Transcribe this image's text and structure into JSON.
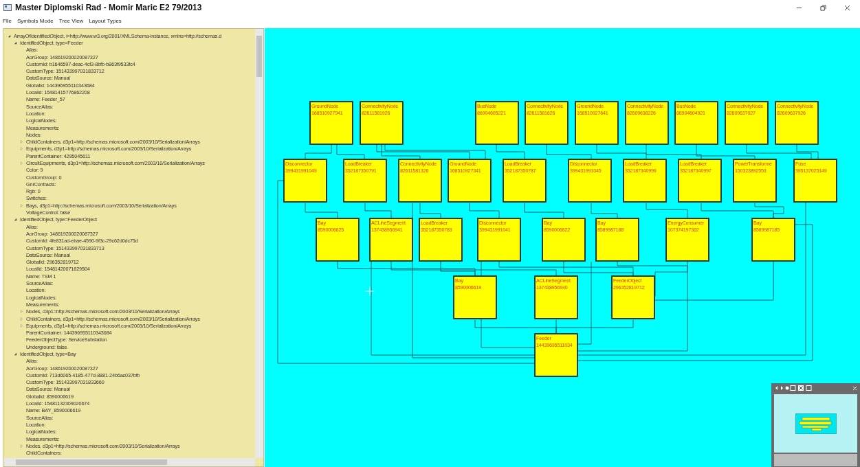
{
  "window": {
    "title": "Master Diplomski Rad - Momir Maric E2 79/2013"
  },
  "menu": [
    "File",
    "Symbols Mode",
    "Tree View",
    "Layout Types"
  ],
  "tree": [
    {
      "text": "ArrayOfIdentifiedObject, i=http://www.w3.org/2001/XMLSchema-instance, xmlns=http://schemas.d",
      "kind": "expanded",
      "children": [
        {
          "text": "IdentifiedObject, type=Feeder",
          "kind": "expanded",
          "children": [
            {
              "text": "Alias:",
              "kind": "leaf"
            },
            {
              "text": "AorGroup: 148619200020087327",
              "kind": "leaf"
            },
            {
              "text": "CustomId: b1646597-deac-4cf3-8bfb-b863f9533fc4",
              "kind": "leaf"
            },
            {
              "text": "CustomType: 151433997031833712",
              "kind": "leaf"
            },
            {
              "text": "DataSource: Manual",
              "kind": "leaf"
            },
            {
              "text": "GlobalId: 144396955110343684",
              "kind": "leaf"
            },
            {
              "text": "LocalId: 15481415776862208",
              "kind": "leaf"
            },
            {
              "text": "Name: Feeder_57",
              "kind": "leaf"
            },
            {
              "text": "SourceAlias:",
              "kind": "leaf"
            },
            {
              "text": "Location:",
              "kind": "leaf"
            },
            {
              "text": "LogicalNodes:",
              "kind": "leaf"
            },
            {
              "text": "Measurements:",
              "kind": "leaf"
            },
            {
              "text": "Nodes:",
              "kind": "leaf"
            },
            {
              "text": "ChildContainers, d3p1=http://schemas.microsoft.com/2003/10/Serialization/Arrays",
              "kind": "collapsed"
            },
            {
              "text": "Equipments, d3p1=http://schemas.microsoft.com/2003/10/Serialization/Arrays",
              "kind": "collapsed"
            },
            {
              "text": "ParentContainer: 4295045611",
              "kind": "leaf"
            },
            {
              "text": "CircuitEquipments, d3p1=http://schemas.microsoft.com/2003/10/Serialization/Arrays",
              "kind": "collapsed"
            },
            {
              "text": "Color: 9",
              "kind": "leaf"
            },
            {
              "text": "CustomGroup: 0",
              "kind": "leaf"
            },
            {
              "text": "GnrContracts:",
              "kind": "leaf"
            },
            {
              "text": "Rgb: 0",
              "kind": "leaf"
            },
            {
              "text": "Switches:",
              "kind": "leaf"
            },
            {
              "text": "Bays, d3p1=http://schemas.microsoft.com/2003/10/Serialization/Arrays",
              "kind": "collapsed"
            },
            {
              "text": "VoltageControl: false",
              "kind": "leaf"
            }
          ]
        },
        {
          "text": "IdentifiedObject, type=FeederObject",
          "kind": "expanded",
          "children": [
            {
              "text": "Alias:",
              "kind": "leaf"
            },
            {
              "text": "AorGroup: 148619200020087327",
              "kind": "leaf"
            },
            {
              "text": "CustomId: 4fe831ad-ebae-4590-9f3c-29c62d0dc75d",
              "kind": "leaf"
            },
            {
              "text": "CustomType: 151433997031833713",
              "kind": "leaf"
            },
            {
              "text": "DataSource: Manual",
              "kind": "leaf"
            },
            {
              "text": "GlobalId: 296352819712",
              "kind": "leaf"
            },
            {
              "text": "LocalId: 15481420071829504",
              "kind": "leaf"
            },
            {
              "text": "Name: TSM 1",
              "kind": "leaf"
            },
            {
              "text": "SourceAlias:",
              "kind": "leaf"
            },
            {
              "text": "Location:",
              "kind": "leaf"
            },
            {
              "text": "LogicalNodes:",
              "kind": "leaf"
            },
            {
              "text": "Measurements:",
              "kind": "leaf"
            },
            {
              "text": "Nodes, d3p1=http://schemas.microsoft.com/2003/10/Serialization/Arrays",
              "kind": "collapsed"
            },
            {
              "text": "ChildContainers, d3p1=http://schemas.microsoft.com/2003/10/Serialization/Arrays",
              "kind": "collapsed"
            },
            {
              "text": "Equipments, d3p1=http://schemas.microsoft.com/2003/10/Serialization/Arrays",
              "kind": "collapsed"
            },
            {
              "text": "ParentContainer: 144396955110343684",
              "kind": "leaf"
            },
            {
              "text": "FeederObjectType: ServiceSubstation",
              "kind": "leaf"
            },
            {
              "text": "Underground: false",
              "kind": "leaf"
            }
          ]
        },
        {
          "text": "IdentifiedObject, type=Bay",
          "kind": "expanded",
          "children": [
            {
              "text": "Alias:",
              "kind": "leaf"
            },
            {
              "text": "AorGroup: 148619200020087327",
              "kind": "leaf"
            },
            {
              "text": "CustomId: 713d6065-4185-477d-8881-24b6ac037bfb",
              "kind": "leaf"
            },
            {
              "text": "CustomType: 151433997031833660",
              "kind": "leaf"
            },
            {
              "text": "DataSource: Manual",
              "kind": "leaf"
            },
            {
              "text": "GlobalId: 8590006619",
              "kind": "leaf"
            },
            {
              "text": "LocalId: 15481132309020674",
              "kind": "leaf"
            },
            {
              "text": "Name: BAY_8590006619",
              "kind": "leaf"
            },
            {
              "text": "SourceAlias:",
              "kind": "leaf"
            },
            {
              "text": "Location:",
              "kind": "leaf"
            },
            {
              "text": "LogicalNodes:",
              "kind": "leaf"
            },
            {
              "text": "Measurements:",
              "kind": "leaf"
            },
            {
              "text": "Nodes, d3p1=http://schemas.microsoft.com/2003/10/Serialization/Arrays",
              "kind": "collapsed"
            },
            {
              "text": "ChildContainers:",
              "kind": "leaf"
            }
          ]
        }
      ]
    }
  ],
  "diagram": {
    "nodes": [
      {
        "type": "GroundNode",
        "id": "168510927941"
      },
      {
        "type": "ConnectivityNode",
        "id": "82611581926"
      },
      {
        "type": "BusNode",
        "id": "86904605221"
      },
      {
        "type": "ConnectivityNode",
        "id": "82611581626"
      },
      {
        "type": "GroundNode",
        "id": "168510927641"
      },
      {
        "type": "ConnectivityNode",
        "id": "82609638226"
      },
      {
        "type": "BusNode",
        "id": "86904604921"
      },
      {
        "type": "ConnectivityNode",
        "id": "82609637927"
      },
      {
        "type": "ConnectivityNode",
        "id": "82609637926"
      },
      {
        "type": "Disconnector",
        "id": "399431991049"
      },
      {
        "type": "LoadBreaker",
        "id": "352187350791"
      },
      {
        "type": "ConnectivityNode",
        "id": "82611581326"
      },
      {
        "type": "GroundNode",
        "id": "168510927341"
      },
      {
        "type": "LoadBreaker",
        "id": "352187350787"
      },
      {
        "type": "Disconnector",
        "id": "399431991045"
      },
      {
        "type": "LoadBreaker",
        "id": "352187340999"
      },
      {
        "type": "LoadBreaker",
        "id": "352187340997"
      },
      {
        "type": "PowerTransforme",
        "id": "150323892553"
      },
      {
        "type": "Fuse",
        "id": "395137025149"
      },
      {
        "type": "Bay",
        "id": "8590006625"
      },
      {
        "type": "ACLineSegment",
        "id": "137438956941"
      },
      {
        "type": "LoadBreaker",
        "id": "352187350783"
      },
      {
        "type": "Disconnector",
        "id": "399431991041"
      },
      {
        "type": "Bay",
        "id": "8590006622"
      },
      {
        "type": "Bay",
        "id": "8589987188"
      },
      {
        "type": "EnergyConsumer",
        "id": "107374197362"
      },
      {
        "type": "Bay",
        "id": "8589987185"
      },
      {
        "type": "Bay",
        "id": "8590006619"
      },
      {
        "type": "ACLineSegment",
        "id": "137438956940"
      },
      {
        "type": "FeederObject",
        "id": "296352819712"
      },
      {
        "type": "Feeder",
        "id": "14439695511034"
      }
    ]
  }
}
